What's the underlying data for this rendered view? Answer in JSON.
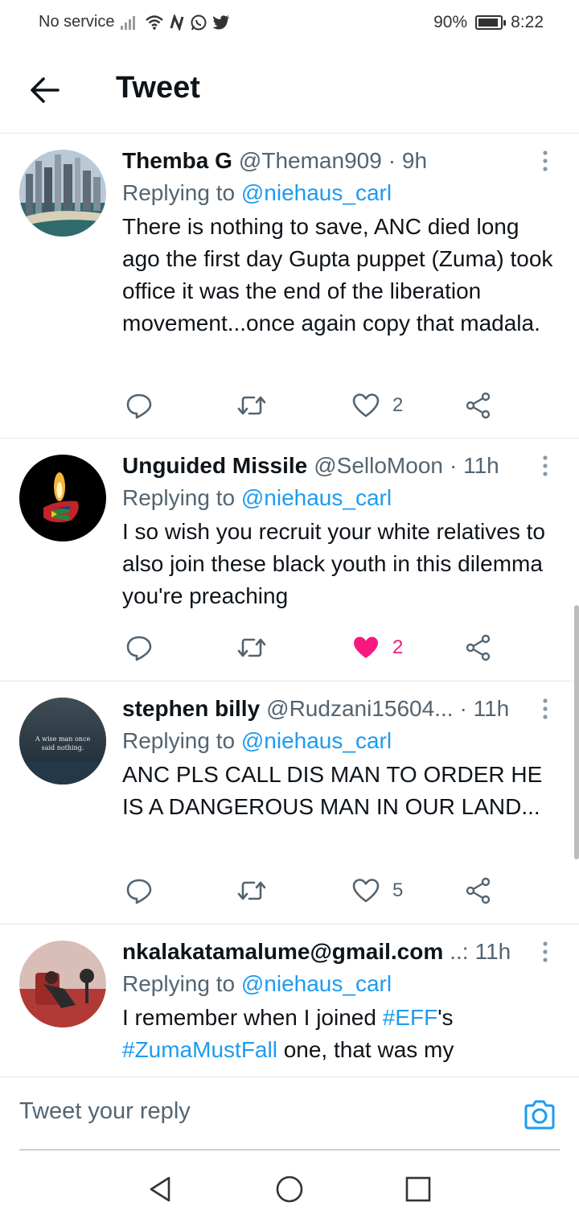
{
  "status_bar": {
    "carrier": "No service",
    "battery": "90%",
    "time": "8:22"
  },
  "header": {
    "title": "Tweet"
  },
  "tweets": [
    {
      "name": "Themba G",
      "handle": "@Theman909",
      "time": "· 9h",
      "replying_prefix": "Replying to ",
      "replying_to": "@niehaus_carl",
      "text": "There is nothing to save, ANC died long ago the first day Gupta puppet (Zuma) took office it was the end of the liberation movement...once again copy that madala.",
      "likes": "2",
      "liked": false
    },
    {
      "name": "Unguided Missile",
      "handle": "@SelloMoon",
      "time": "· 11h",
      "replying_prefix": "Replying to ",
      "replying_to": "@niehaus_carl",
      "text": "I so wish you recruit your white relatives to also join these black youth in this dilemma you're preaching",
      "likes": "2",
      "liked": true
    },
    {
      "name": "stephen billy",
      "handle": "@Rudzani15604...",
      "time": "· 11h",
      "replying_prefix": "Replying to ",
      "replying_to": "@niehaus_carl",
      "text": "ANC PLS CALL DIS MAN TO ORDER HE IS A DANGEROUS MAN IN OUR LAND...",
      "likes": "5",
      "liked": false,
      "avatar_text": "A wise man once said nothing."
    },
    {
      "name": "nkalakatamalume@gmail.com",
      "handle": "..:",
      "time": "11h",
      "replying_prefix": "Replying to ",
      "replying_to": "@niehaus_carl",
      "text_parts": [
        "I remember when I joined ",
        "#EFF",
        "'s ",
        "#ZumaMustFall",
        " one, that was my"
      ]
    }
  ],
  "reply_bar": {
    "placeholder": "Tweet your reply"
  },
  "colors": {
    "link": "#1d9bf0",
    "like": "#f91880",
    "secondary": "#536471"
  }
}
